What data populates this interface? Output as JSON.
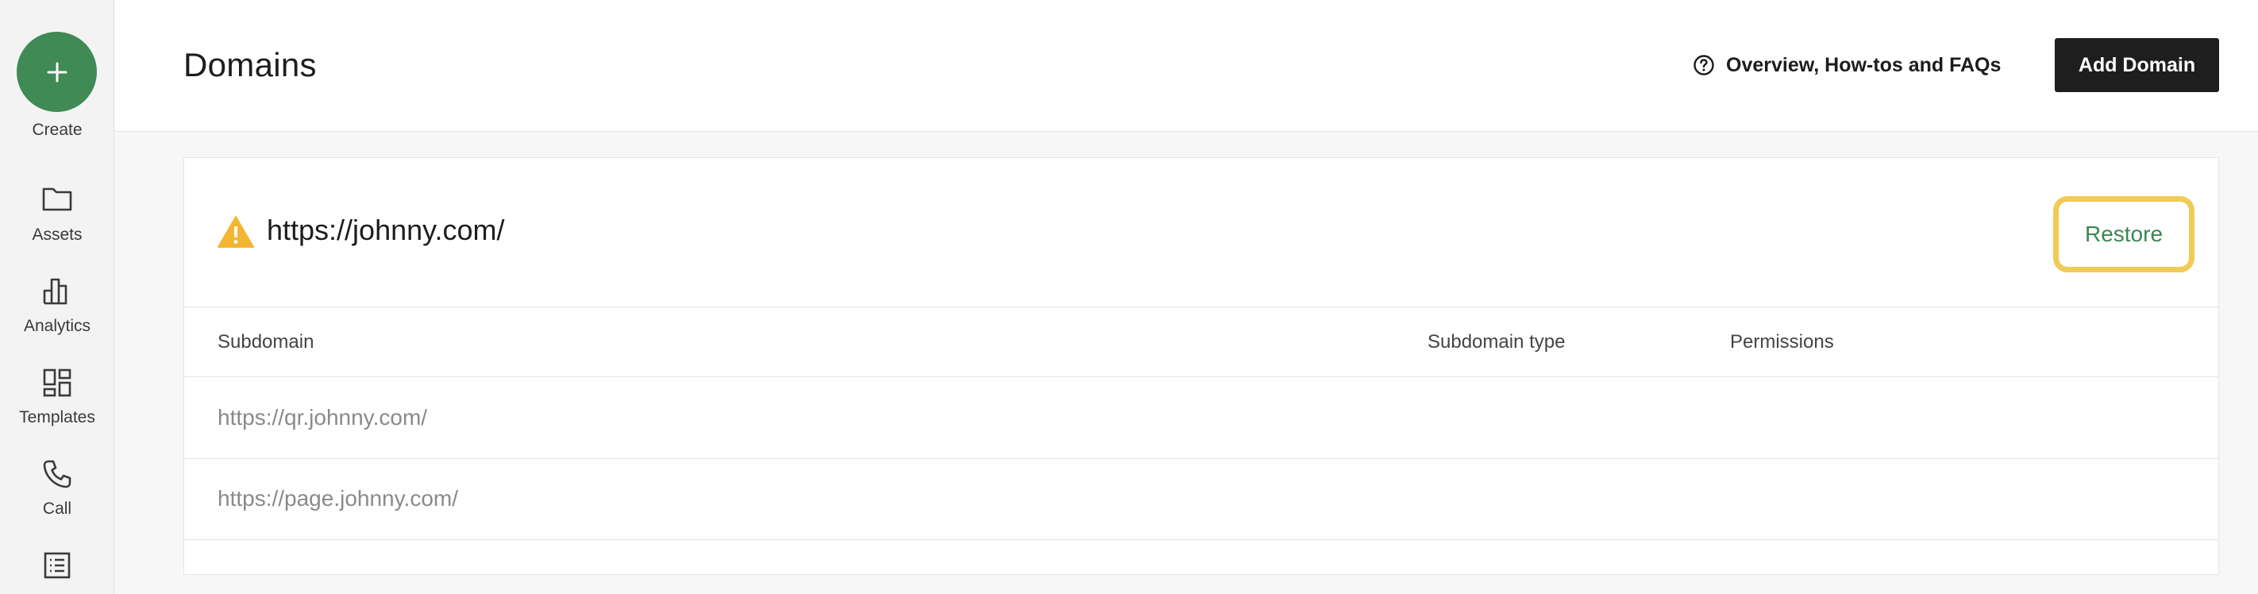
{
  "sidebar": {
    "create_label": "Create",
    "items": [
      {
        "label": "Assets",
        "icon": "folder-icon"
      },
      {
        "label": "Analytics",
        "icon": "bar-chart-icon"
      },
      {
        "label": "Templates",
        "icon": "dashboard-icon"
      },
      {
        "label": "Call",
        "icon": "phone-icon"
      },
      {
        "label": "",
        "icon": "list-document-icon"
      }
    ]
  },
  "header": {
    "title": "Domains",
    "help_link": "Overview, How-tos and FAQs",
    "add_domain_label": "Add Domain"
  },
  "domain": {
    "url": "https://johnny.com/",
    "status_icon": "warning-icon",
    "restore_label": "Restore"
  },
  "table": {
    "columns": [
      "Subdomain",
      "Subdomain type",
      "Permissions"
    ],
    "rows": [
      {
        "subdomain": "https://qr.johnny.com/",
        "type": "",
        "permissions": ""
      },
      {
        "subdomain": "https://page.johnny.com/",
        "type": "",
        "permissions": ""
      }
    ]
  },
  "colors": {
    "accent_green": "#3f8a55",
    "highlight_yellow": "#f0cb55",
    "warning_yellow": "#f2b632",
    "primary_button": "#1e1e1e"
  }
}
